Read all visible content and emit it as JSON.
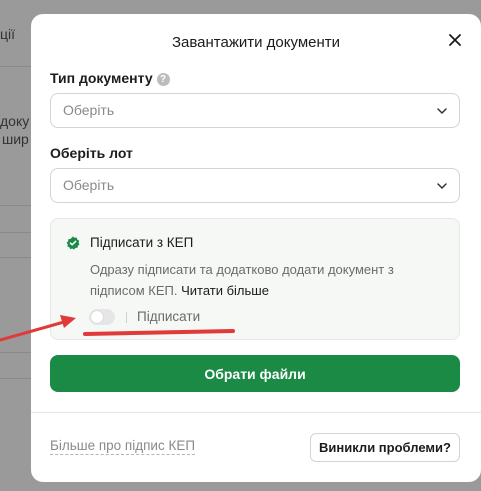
{
  "background": {
    "text_fragments": [
      "ції",
      "доку",
      "шир"
    ]
  },
  "modal": {
    "title": "Завантажити документи",
    "close_icon": "close-icon",
    "doc_type": {
      "label": "Тип документу",
      "help_icon": "question-circle-icon",
      "placeholder": "Оберіть"
    },
    "lot": {
      "label": "Оберіть лот",
      "placeholder": "Оберіть"
    },
    "kep": {
      "title": "Підписати з КЕП",
      "description": "Одразу підписати та додатково додати документ з підписом КЕП.",
      "read_more": "Читати більше",
      "toggle_label": "Підписати",
      "toggle_on": false
    },
    "primary_button": "Обрати файли",
    "footer_link": "Більше про підпис КЕП",
    "secondary_button": "Виникли проблеми?"
  },
  "colors": {
    "primary": "#1a8a45",
    "annotation": "#e03a3a",
    "overlay": "#9a9a9a"
  }
}
